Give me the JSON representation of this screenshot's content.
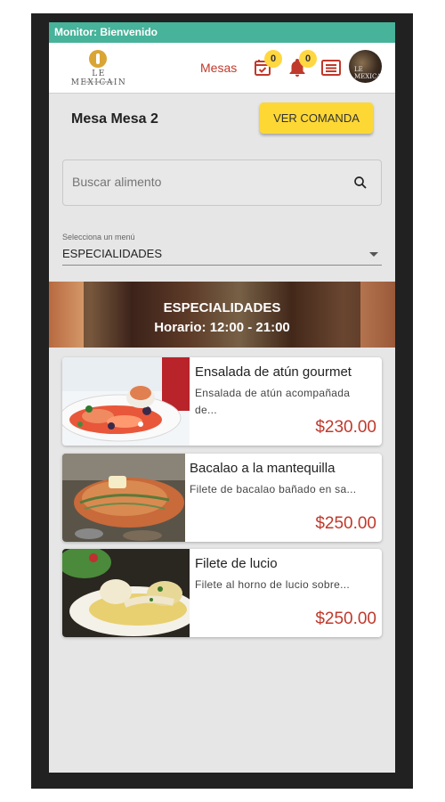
{
  "status_bar": {
    "text": "Monitor: Bienvenido"
  },
  "header": {
    "logo_text": "LE MEXICAIN",
    "logo_subtext": "Saber mas para tu",
    "nav_link": "Mesas",
    "orders_badge": "0",
    "notifications_badge": "0",
    "avatar_text": "LE MEXICAIN"
  },
  "mesa": {
    "title": "Mesa Mesa 2",
    "ver_comanda": "VER COMANDA"
  },
  "search": {
    "placeholder": "Buscar alimento"
  },
  "menu_select": {
    "label": "Selecciona un menú",
    "value": "ESPECIALIDADES"
  },
  "banner": {
    "title": "ESPECIALIDADES",
    "schedule": "Horario: 12:00 - 21:00"
  },
  "items": [
    {
      "name": "Ensalada de atún gourmet",
      "description_line1": "Ensalada de atún acompañada",
      "description_line2": "de...",
      "price": "$230.00"
    },
    {
      "name": "Bacalao a la mantequilla",
      "description": "Filete de bacalao bañado en sa...",
      "price": "$250.00"
    },
    {
      "name": "Filete de lucio",
      "description": "Filete al horno de lucio sobre...",
      "price": "$250.00"
    }
  ],
  "colors": {
    "status_bar": "#46b39a",
    "accent_red": "#c0392b",
    "button_yellow": "#fdd835",
    "badge_yellow": "#ffd740"
  }
}
